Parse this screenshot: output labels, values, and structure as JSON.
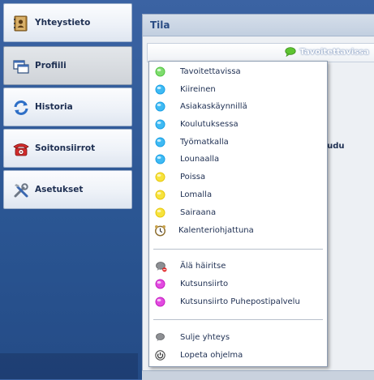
{
  "nav": {
    "items": [
      {
        "label": "Yhteystieto",
        "icon": "address-book-icon"
      },
      {
        "label": "Profiili",
        "icon": "windows-icon"
      },
      {
        "label": "Historia",
        "icon": "refresh-icon"
      },
      {
        "label": "Soitonsiirrot",
        "icon": "phone-icon"
      },
      {
        "label": "Asetukset",
        "icon": "tools-icon"
      }
    ],
    "active": "Profiili"
  },
  "panel": {
    "title": "Tila",
    "current_status": "Tavoitettavissa",
    "partial_text": "rjaudu"
  },
  "menu": {
    "statuses": [
      {
        "label": "Tavoitettavissa",
        "color": "#52c541"
      },
      {
        "label": "Kiireinen",
        "color": "#1aa0e6"
      },
      {
        "label": "Asiakaskäynnillä",
        "color": "#1aa0e6"
      },
      {
        "label": "Koulutuksessa",
        "color": "#1aa0e6"
      },
      {
        "label": "Työmatkalla",
        "color": "#1aa0e6"
      },
      {
        "label": "Lounaalla",
        "color": "#1aa0e6"
      },
      {
        "label": "Poissa",
        "color": "#f2d21b"
      },
      {
        "label": "Lomalla",
        "color": "#f2d21b"
      },
      {
        "label": "Sairaana",
        "color": "#f2d21b"
      }
    ],
    "calendar_label": "Kalenteriohjattuna",
    "forwarding": [
      {
        "label": "Älä häiritse",
        "icon": "do-not-disturb-icon"
      },
      {
        "label": "Kutsunsiirto",
        "color": "#d426c8"
      },
      {
        "label": "Kutsunsiirto Puhepostipalvelu",
        "color": "#d426c8"
      }
    ],
    "actions": [
      {
        "label": "Sulje yhteys",
        "icon": "close-connection-icon"
      },
      {
        "label": "Lopeta ohjelma",
        "icon": "power-icon"
      }
    ]
  }
}
